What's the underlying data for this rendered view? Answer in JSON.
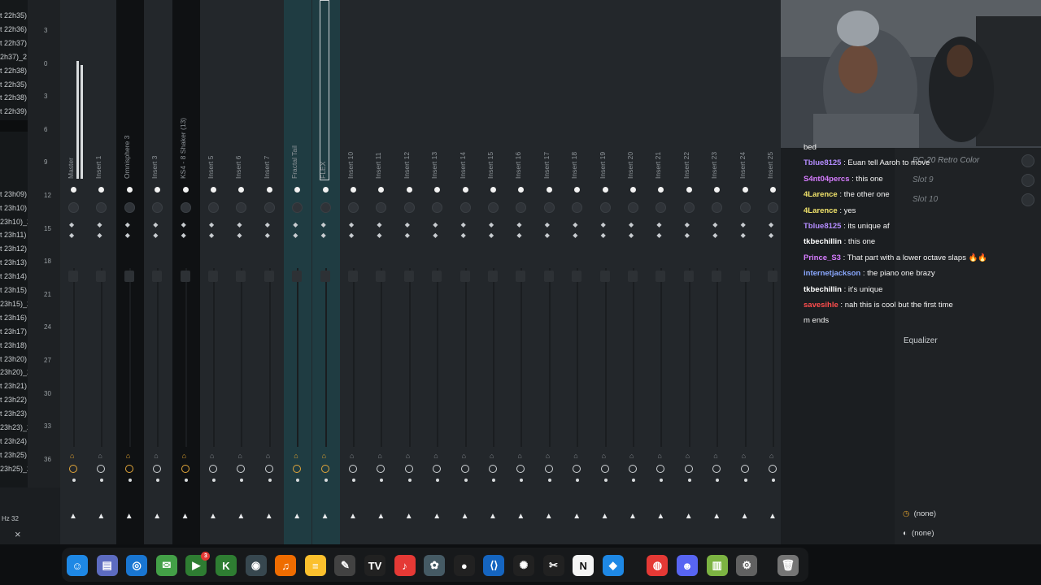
{
  "left_list": [
    "t 22h35)",
    "t 22h36)",
    "t 22h37)",
    "2h37)_2",
    "t 22h38)",
    "t 22h35)",
    "t 22h38)",
    "t 22h39)",
    "",
    "",
    "",
    "",
    "",
    "t 23h09)",
    "t 23h10)",
    "23h10)_2",
    "t 23h11)",
    "t 23h12)",
    "t 23h13)",
    "t 23h14)",
    "t 23h15)",
    "23h15)_2",
    "t 23h16)",
    "t 23h17)",
    "t 23h18)",
    "t 23h20)",
    "23h20)_2",
    "t 23h21)",
    "t 23h22)",
    "t 23h23)",
    "23h23)_2",
    "t 23h24)",
    "t 23h25)",
    "23h25)_2"
  ],
  "scale": [
    "3",
    "0",
    "3",
    "6",
    "9",
    "12",
    "15",
    "18",
    "21",
    "24",
    "27",
    "30",
    "33",
    "36"
  ],
  "mixer": {
    "strips": [
      {
        "label": "Master",
        "type": "normal"
      },
      {
        "label": "Insert 1",
        "type": "normal"
      },
      {
        "label": "Omnisphere 3",
        "type": "dark"
      },
      {
        "label": "Insert 3",
        "type": "normal"
      },
      {
        "label": "KS4 - 8 Shaker (13)",
        "type": "dark"
      },
      {
        "label": "Insert 5",
        "type": "normal"
      },
      {
        "label": "Insert 6",
        "type": "normal"
      },
      {
        "label": "Insert 7",
        "type": "normal"
      },
      {
        "label": "Fractal Tail",
        "type": "sel"
      },
      {
        "label": "FLEX",
        "type": "sel"
      },
      {
        "label": "Insert 10",
        "type": "normal"
      },
      {
        "label": "Insert 11",
        "type": "normal"
      },
      {
        "label": "Insert 12",
        "type": "normal"
      },
      {
        "label": "Insert 13",
        "type": "normal"
      },
      {
        "label": "Insert 14",
        "type": "normal"
      },
      {
        "label": "Insert 15",
        "type": "normal"
      },
      {
        "label": "Insert 16",
        "type": "normal"
      },
      {
        "label": "Insert 17",
        "type": "normal"
      },
      {
        "label": "Insert 18",
        "type": "normal"
      },
      {
        "label": "Insert 19",
        "type": "normal"
      },
      {
        "label": "Insert 20",
        "type": "normal"
      },
      {
        "label": "Insert 21",
        "type": "normal"
      },
      {
        "label": "Insert 22",
        "type": "normal"
      },
      {
        "label": "Insert 23",
        "type": "normal"
      },
      {
        "label": "Insert 24",
        "type": "normal"
      },
      {
        "label": "Insert 25",
        "type": "normal"
      }
    ]
  },
  "chat": [
    {
      "user": "",
      "text": "bed",
      "color": "#ffffff"
    },
    {
      "user": "Tblue8125",
      "text": " : Euan tell Aaroh to move",
      "color": "#b48cff"
    },
    {
      "user": "S4nt04percs",
      "text": " : this one",
      "color": "#d77cff"
    },
    {
      "user": "4Larence",
      "text": " : the other one",
      "color": "#f2e46b"
    },
    {
      "user": "4Larence",
      "text": " : yes",
      "color": "#f2e46b"
    },
    {
      "user": "Tblue8125",
      "text": " : its unique af",
      "color": "#b48cff"
    },
    {
      "user": "tkbechillin",
      "text": " : this one",
      "color": "#ffffff"
    },
    {
      "user": "Prince_S3",
      "text": " : That part with a lower octave slaps 🔥🔥",
      "color": "#d77cff"
    },
    {
      "user": "internetjackson",
      "text": " : the piano one brazy",
      "color": "#8aa8ff"
    },
    {
      "user": "tkbechillin",
      "text": " : it's unique",
      "color": "#ffffff"
    },
    {
      "user": "savesihle",
      "text": " : nah this is cool but the first time",
      "color": "#ff4d4d"
    },
    {
      "user": "",
      "text": "m ends",
      "color": "#ffffff"
    }
  ],
  "rightpanel": {
    "slot_header": "PC-20 Retro Color",
    "slots": [
      "Slot 9",
      "Slot 10"
    ],
    "eq_label": "Equalizer",
    "none1": "(none)",
    "none2": "(none)"
  },
  "bottom_left": {
    "rate": "Hz 32",
    "close": "×"
  },
  "dock": [
    {
      "name": "finder",
      "glyph": "☺",
      "color": "#1e88e5"
    },
    {
      "name": "files",
      "glyph": "▤",
      "color": "#5c6bc0"
    },
    {
      "name": "safari",
      "glyph": "◎",
      "color": "#1976d2"
    },
    {
      "name": "messages",
      "glyph": "✉",
      "color": "#43a047"
    },
    {
      "name": "facetime",
      "glyph": "▶",
      "color": "#2e7d32",
      "badge": "3"
    },
    {
      "name": "k-app",
      "glyph": "K",
      "color": "#2e7d32"
    },
    {
      "name": "obs",
      "glyph": "◉",
      "color": "#37474f"
    },
    {
      "name": "fl-studio",
      "glyph": "♫",
      "color": "#ef6c00"
    },
    {
      "name": "notes",
      "glyph": "≡",
      "color": "#fbc02d"
    },
    {
      "name": "pen",
      "glyph": "✎",
      "color": "#424242"
    },
    {
      "name": "tradingview",
      "glyph": "TV",
      "color": "#212121"
    },
    {
      "name": "music",
      "glyph": "♪",
      "color": "#e53935"
    },
    {
      "name": "davinci",
      "glyph": "✿",
      "color": "#455a64"
    },
    {
      "name": "github",
      "glyph": "●",
      "color": "#212121"
    },
    {
      "name": "vscode",
      "glyph": "⟨⟩",
      "color": "#1565c0"
    },
    {
      "name": "chatgpt",
      "glyph": "✺",
      "color": "#212121"
    },
    {
      "name": "capcut",
      "glyph": "✂",
      "color": "#212121"
    },
    {
      "name": "notion",
      "glyph": "N",
      "color": "#f5f5f5"
    },
    {
      "name": "cube",
      "glyph": "◆",
      "color": "#1e88e5"
    },
    {
      "name": "chrome",
      "glyph": "◍",
      "color": "#e53935"
    },
    {
      "name": "discord",
      "glyph": "☻",
      "color": "#5865f2"
    },
    {
      "name": "colors",
      "glyph": "▥",
      "color": "#7cb342"
    },
    {
      "name": "settings",
      "glyph": "⚙",
      "color": "#616161"
    },
    {
      "name": "trash",
      "glyph": "🗑",
      "color": "#757575"
    }
  ]
}
